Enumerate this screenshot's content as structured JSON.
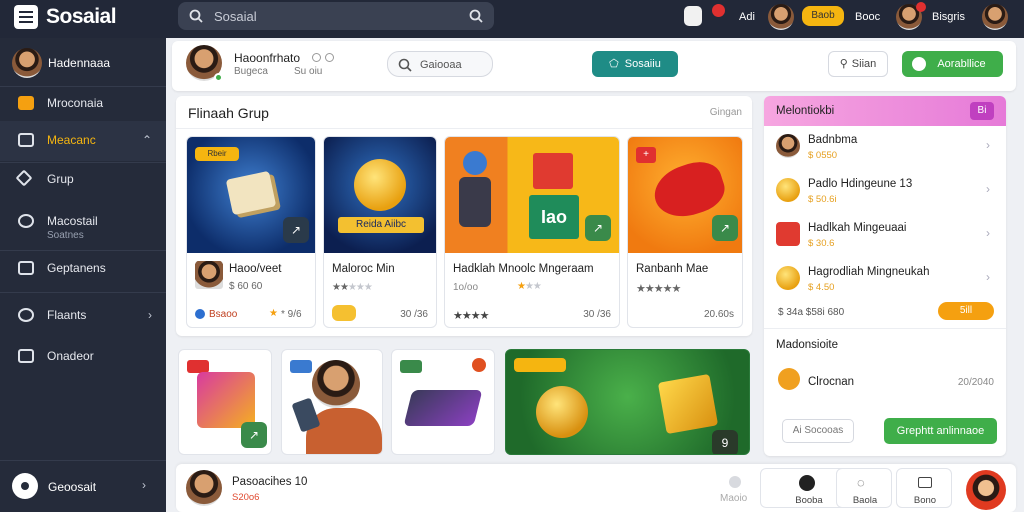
{
  "topbar": {
    "app_name": "Sosaial",
    "search_placeholder": "Sosaial",
    "link_1": "Adi",
    "pill_label": "Baob",
    "link_2": "Booc",
    "link_3": "Bisgris"
  },
  "sidebar": {
    "user_name": "Hadennaaa",
    "items": [
      {
        "label": "Mroconaia"
      },
      {
        "label": "Meacanc"
      },
      {
        "label": "Grup"
      },
      {
        "label": "Macostail",
        "sub": "Soatnes"
      },
      {
        "label": "Geptanens"
      },
      {
        "label": "Flaants"
      },
      {
        "label": "Onadeor"
      }
    ],
    "footer_label": "Geoosait"
  },
  "profile": {
    "name": "Haoonfrhato",
    "sub_1": "Bugeca",
    "sub_2": "Su oiu",
    "search_label": "Gaiooaa",
    "teal_button": "Sosaiiu",
    "outline_button": "Siian",
    "green_button": "Aorabllice"
  },
  "featured": {
    "title": "Flinaah Grup",
    "more_label": "Gingan",
    "cards": [
      {
        "tag": "Rbeir",
        "name": "Haoo/veet",
        "meta": "$ 60 60",
        "footer": "Bsaoo",
        "rating": "* 9/6"
      },
      {
        "img_text": "Reida Aiibc",
        "name": "Maloroc Min",
        "meta": "",
        "footer": "",
        "rating": "30 /36"
      },
      {
        "img_text": "Iao",
        "name": "Hadklah Mnoolc Mngeraam",
        "meta": "1o/oo",
        "footer": "",
        "rating": "30 /36"
      },
      {
        "name": "Ranbanh Mae",
        "meta": "",
        "footer": "",
        "rating": "20.60s"
      }
    ]
  },
  "right_panel": {
    "title": "Melontiokbi",
    "badge": "Bi",
    "items": [
      {
        "name": "Badnbma",
        "sub": "$ 0550"
      },
      {
        "name": "Padlo Hdingeune 13",
        "sub": "$ 50.6i"
      },
      {
        "name": "Hadlkah Mingeuaai",
        "sub": "$ 30.6"
      },
      {
        "name": "Hagrodliah Mingneukah",
        "sub": "$ 4.50"
      }
    ],
    "price_row": "$ 34a  $58i 680",
    "action_pill": "5ill",
    "section_title": "Madonsioite",
    "member_name": "Clrocnan",
    "member_time": "20/2040",
    "secondary_button": "Ai Socooas",
    "primary_button": "Grephtt anlinnaoe"
  },
  "bottom_bar": {
    "name": "Pasoacihes 10",
    "sub": "S20o6",
    "link": "Maoio",
    "btn_1": "Booba",
    "btn_2": "Baola",
    "btn_3": "Bono"
  },
  "colors": {
    "sidebar_bg": "#252b3a",
    "accent_yellow": "#f5b510",
    "accent_green": "#3fae4a",
    "accent_teal": "#1f8c86",
    "accent_pink": "#e67ad8"
  }
}
